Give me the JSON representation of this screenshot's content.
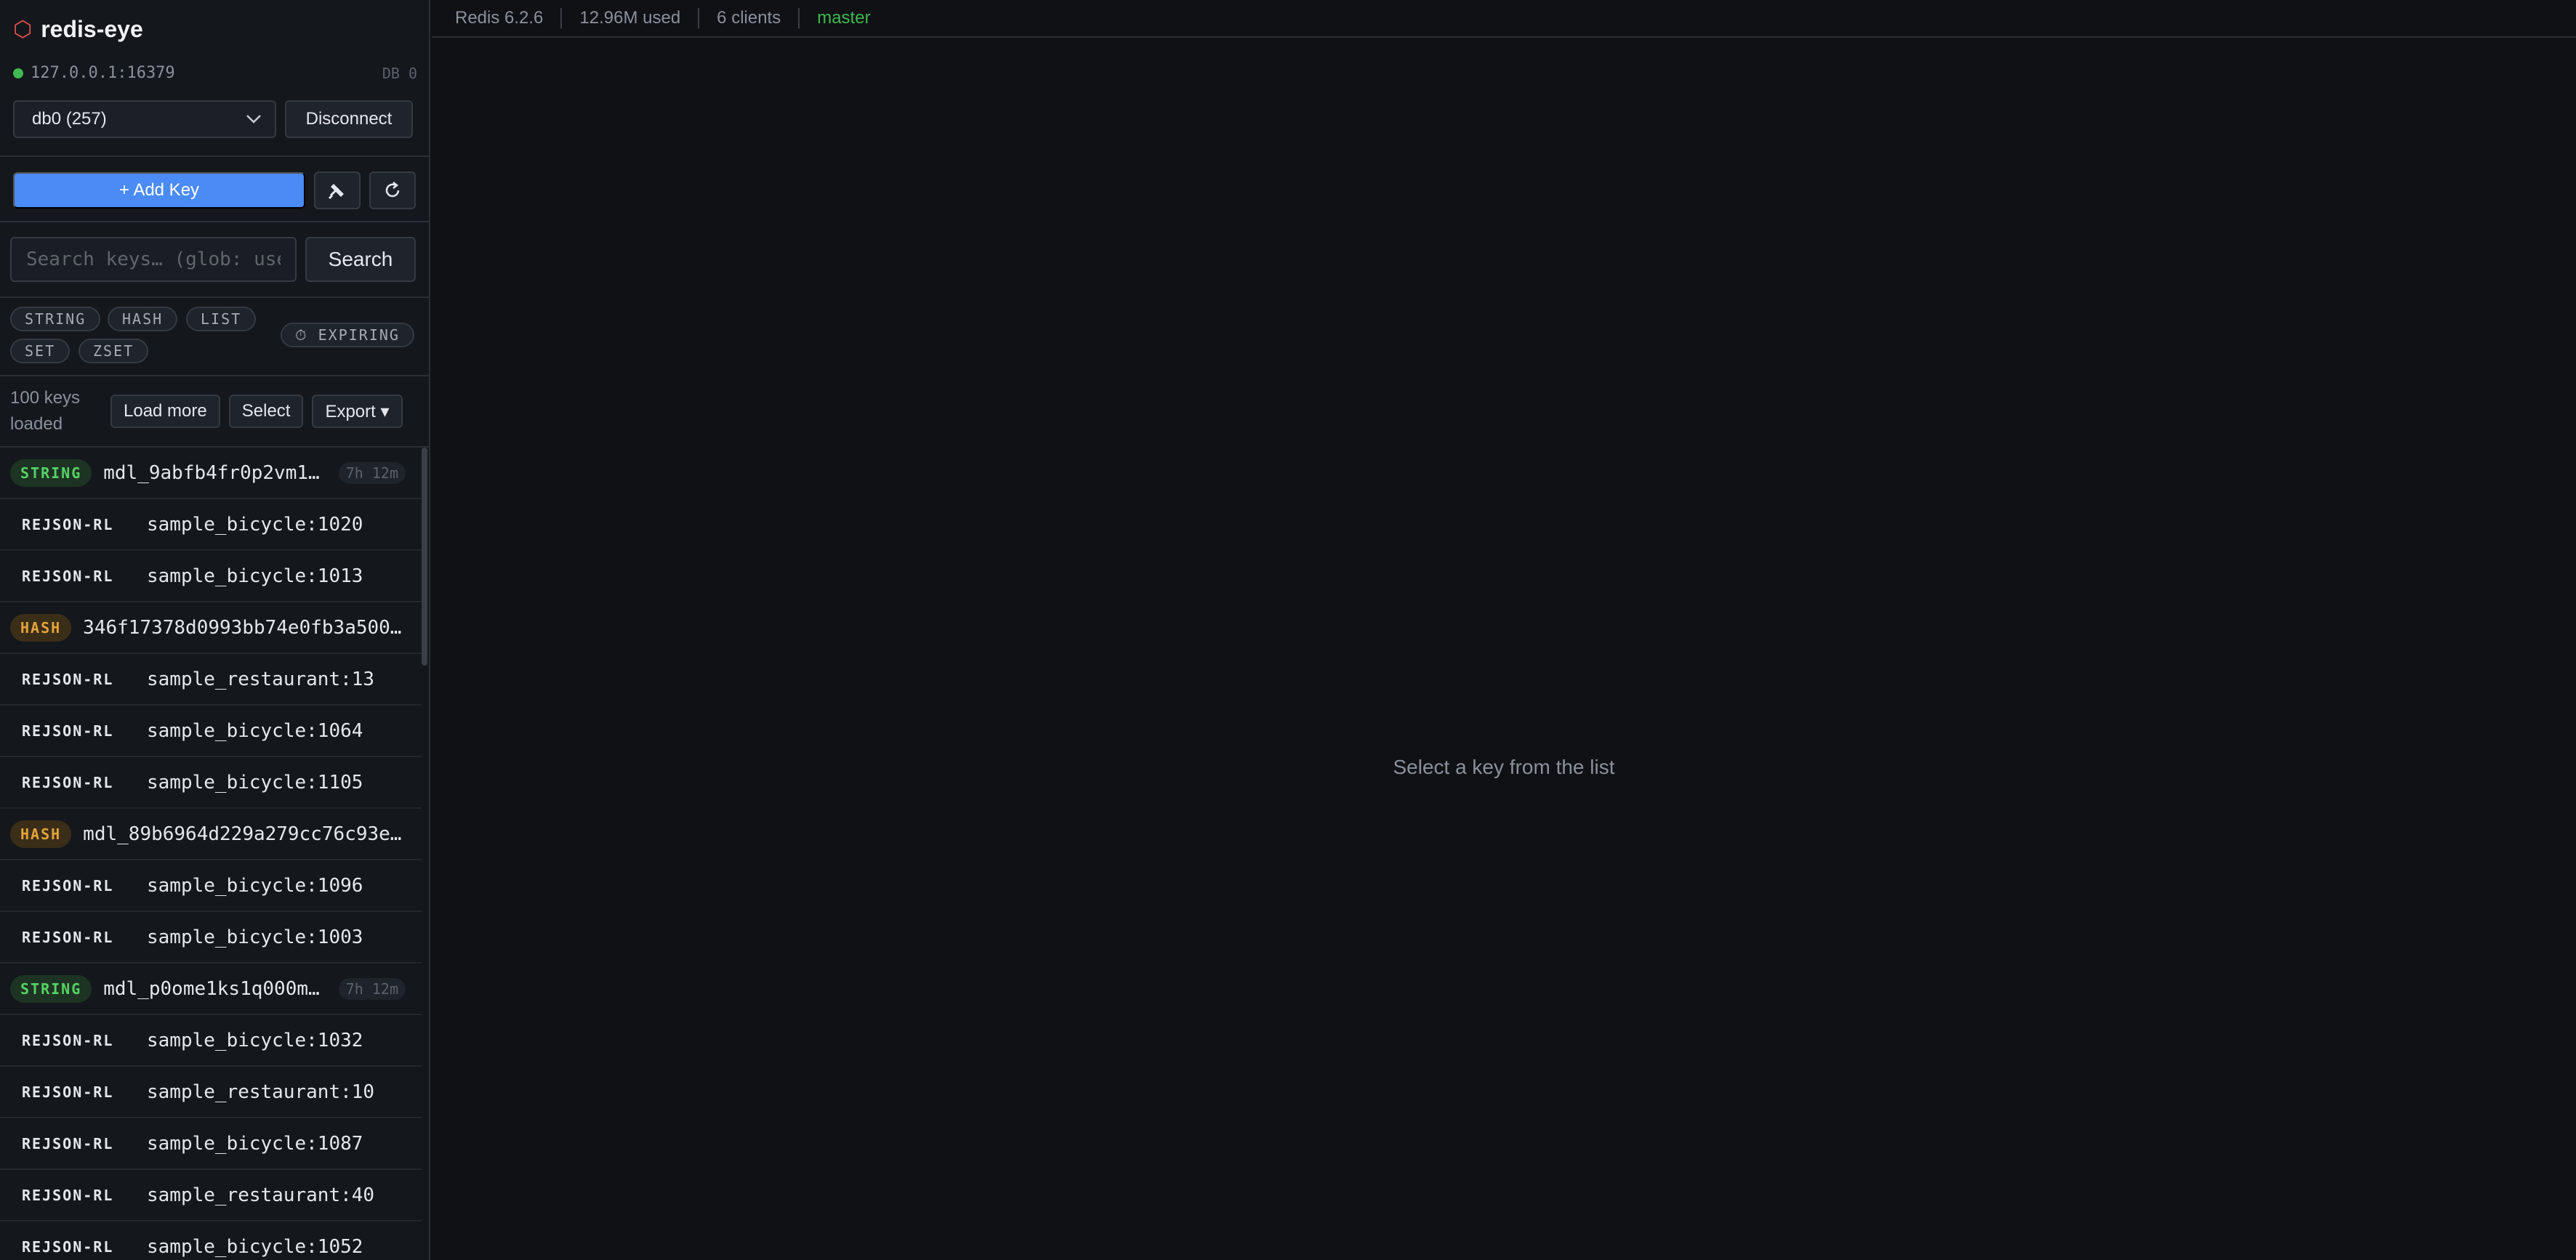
{
  "app": {
    "title": "redis-eye"
  },
  "connection": {
    "address": "127.0.0.1:16379",
    "db_label": "DB 0"
  },
  "db_select": {
    "value": "db0 (257)"
  },
  "buttons": {
    "disconnect": "Disconnect",
    "add_key": "+ Add Key",
    "search": "Search",
    "load_more": "Load more",
    "select": "Select",
    "export": "Export ▾"
  },
  "search": {
    "placeholder": "Search keys… (glob: user:*)"
  },
  "filters": {
    "types": [
      "STRING",
      "HASH",
      "LIST",
      "SET",
      "ZSET"
    ],
    "expiring": "⏱ EXPIRING"
  },
  "key_count": {
    "line1": "100 keys",
    "line2": "loaded"
  },
  "keys": [
    {
      "type": "STRING",
      "name": "mdl_9abfb4fr0p2vm1…",
      "ttl": "7h 12m"
    },
    {
      "type": "REJSON-RL",
      "name": "sample_bicycle:1020"
    },
    {
      "type": "REJSON-RL",
      "name": "sample_bicycle:1013"
    },
    {
      "type": "HASH",
      "name": "346f17378d0993bb74e0fb3a500…"
    },
    {
      "type": "REJSON-RL",
      "name": "sample_restaurant:13"
    },
    {
      "type": "REJSON-RL",
      "name": "sample_bicycle:1064"
    },
    {
      "type": "REJSON-RL",
      "name": "sample_bicycle:1105"
    },
    {
      "type": "HASH",
      "name": "mdl_89b6964d229a279cc76c93e…"
    },
    {
      "type": "REJSON-RL",
      "name": "sample_bicycle:1096"
    },
    {
      "type": "REJSON-RL",
      "name": "sample_bicycle:1003"
    },
    {
      "type": "STRING",
      "name": "mdl_p0ome1ks1q000m…",
      "ttl": "7h 12m"
    },
    {
      "type": "REJSON-RL",
      "name": "sample_bicycle:1032"
    },
    {
      "type": "REJSON-RL",
      "name": "sample_restaurant:10"
    },
    {
      "type": "REJSON-RL",
      "name": "sample_bicycle:1087"
    },
    {
      "type": "REJSON-RL",
      "name": "sample_restaurant:40"
    },
    {
      "type": "REJSON-RL",
      "name": "sample_bicycle:1052"
    }
  ],
  "status": {
    "version": "Redis 6.2.6",
    "memory": "12.96M used",
    "clients": "6 clients",
    "role": "master"
  },
  "empty_state": "Select a key from the list",
  "colors": {
    "accent": "#4a8bf5",
    "brand": "#e5534b",
    "ok": "#3fb950",
    "string": "#56d364",
    "hash": "#e3a43b"
  },
  "icons": {
    "brand": "hexagon-icon",
    "chevron": "chevron-down-icon",
    "broadcast": "satellite-icon",
    "refresh": "refresh-icon"
  }
}
